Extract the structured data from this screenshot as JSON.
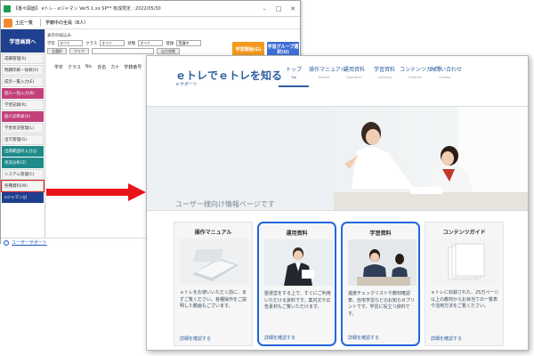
{
  "back_window": {
    "title": "【番々図面】 eトレ - eジャマン Ver5.1.xx SP** 有成限定 : 2022/05/30",
    "user_name": "土庄一覧",
    "user_status": "学籍中の全員（8人）",
    "sidebar_top_label": "学習画面へ",
    "sidebar_items": [
      {
        "label": "成績管理(S)",
        "style": "plain"
      },
      {
        "label": "問題印刷・採択(V)",
        "style": "plain"
      },
      {
        "label": "成否一覧入力(E)",
        "style": "plain"
      },
      {
        "label": "個人一括入力(B)",
        "style": "pink"
      },
      {
        "label": "学習記録(R)",
        "style": "plain"
      },
      {
        "label": "個人診断表(X)",
        "style": "pink"
      },
      {
        "label": "学習状況管理(L)",
        "style": "plain"
      },
      {
        "label": "出欠管理(G)",
        "style": "plain"
      },
      {
        "label": "出題範囲の入力(J)",
        "style": "teal"
      },
      {
        "label": "状況分析(Z)",
        "style": "teal"
      },
      {
        "label": "システム管理(C)",
        "style": "plain"
      },
      {
        "label": "各種資料(W)",
        "style": "plain",
        "selected": true
      },
      {
        "label": "eジャマン(J)",
        "style": "navy"
      }
    ],
    "filters": {
      "row_label": "表示の絞込み",
      "school_label": "学年",
      "school_value": "すべて",
      "class_label": "クラス",
      "class_value": "すべて",
      "status_label": "状態",
      "status_value": "すべて",
      "seat_label": "登録",
      "seat_value": "受講中",
      "all_btn": "全選択",
      "clear_btn": "クリア",
      "output_btn": "出力状態"
    },
    "big_buttons": {
      "gakusei": "学習開始(G)",
      "group": "学習グループ選択(U)"
    },
    "table_headers": [
      "学年",
      "クラス",
      "No.",
      "氏名",
      "カナ",
      "学籍番号",
      "学校",
      "種別",
      "状態",
      "入室状態"
    ],
    "footer_link": "ユーザーサポート"
  },
  "site": {
    "logo_title": "ｅトレでｅトレを知る",
    "logo_sub": "ｅサポート",
    "nav": [
      {
        "jp": "トップ",
        "en": "Top",
        "active": true
      },
      {
        "jp": "操作マニュアル",
        "en": "Manual"
      },
      {
        "jp": "運用資料",
        "en": "Operation"
      },
      {
        "jp": "学習資料",
        "en": "Learning"
      },
      {
        "jp": "コンテンツガイド",
        "en": "Contents"
      },
      {
        "jp": "お問い合わせ",
        "en": "Contact"
      }
    ],
    "hero_caption": "ユーザー様向け情報ページです",
    "cards": [
      {
        "title": "操作マニュアル",
        "desc": "ｅトレをお使いいただく前に、まずご覧ください。各種操作をご説明した動画もございます。",
        "link": "詳細を確認する",
        "highlight": false
      },
      {
        "title": "運用資料",
        "desc": "塾運営をする上で、すぐにご利用いただける資料です。案内文や広告素材もご覧いただけます。",
        "link": "詳細を確認する",
        "highlight": true
      },
      {
        "title": "学習資料",
        "desc": "進度チェックリストや教材確認表、自宅学習などのお知らせプリントです。学習に役立つ資料です。",
        "link": "詳細を確認する",
        "highlight": true
      },
      {
        "title": "コンテンツガイド",
        "desc": "ｅトレに収録された、25万ページ以上の教材からお目当ての一覧表や活用方法をご覧ください。",
        "link": "詳細を確認する",
        "highlight": false
      }
    ]
  },
  "colors": {
    "arrow": "#e8141a",
    "highlight_border": "#2266dd",
    "brand": "#2d5f9e"
  }
}
